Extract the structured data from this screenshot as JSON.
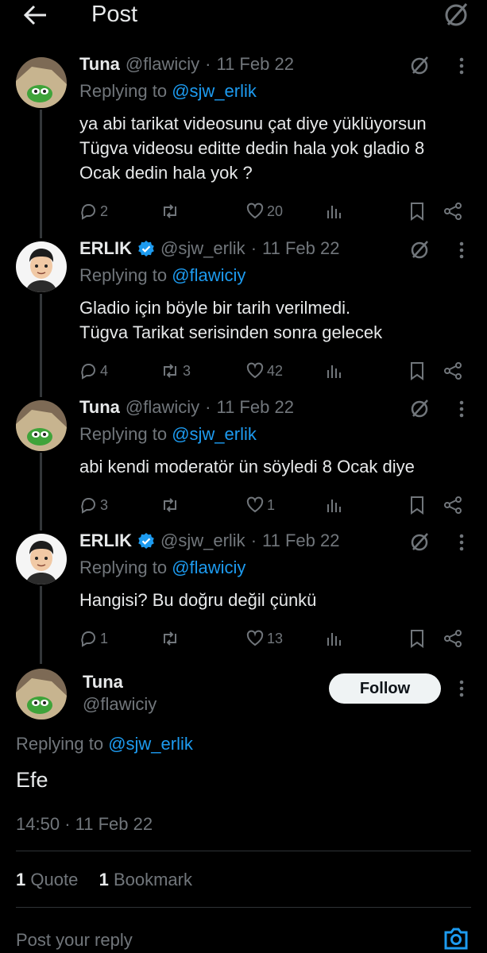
{
  "header": {
    "title": "Post",
    "back_icon": "arrow-left-icon",
    "grok_icon": "slash-circle-icon"
  },
  "replies": [
    {
      "name": "Tuna",
      "handle": "@flawiciy",
      "sep": "·",
      "date": "11 Feb 22",
      "replying_prefix": "Replying to",
      "replying_to": "@sjw_erlik",
      "text": [
        "ya abi tarikat videosunu çat diye yüklüyorsun",
        "Tügva videosu editte dedin hala yok gladio 8",
        "Ocak dedin hala yok ?"
      ],
      "replies": "2",
      "reposts": "",
      "likes": "20"
    },
    {
      "name": "ERLIK",
      "verified": true,
      "handle": "@sjw_erlik",
      "sep": "·",
      "date": "11 Feb 22",
      "replying_prefix": "Replying to",
      "replying_to": "@flawiciy",
      "text": [
        "Gladio için böyle bir tarih verilmedi.",
        "Tügva Tarikat serisinden sonra gelecek"
      ],
      "replies": "4",
      "reposts": "3",
      "likes": "42"
    },
    {
      "name": "Tuna",
      "handle": "@flawiciy",
      "sep": "·",
      "date": "11 Feb 22",
      "replying_prefix": "Replying to",
      "replying_to": "@sjw_erlik",
      "text": [
        "abi kendi moderatör ün söyledi 8 Ocak diye"
      ],
      "replies": "3",
      "reposts": "",
      "likes": "1"
    },
    {
      "name": "ERLIK",
      "verified": true,
      "handle": "@sjw_erlik",
      "sep": "·",
      "date": "11 Feb 22",
      "replying_prefix": "Replying to",
      "replying_to": "@flawiciy",
      "text": [
        "Hangisi? Bu doğru değil çünkü"
      ],
      "replies": "1",
      "reposts": "",
      "likes": "13"
    }
  ],
  "main_post": {
    "name": "Tuna",
    "handle": "@flawiciy",
    "follow_label": "Follow",
    "replying_prefix": "Replying to",
    "replying_to": "@sjw_erlik",
    "text": "Efe",
    "time": "14:50",
    "sep": "·",
    "date": "11 Feb 22",
    "stats": {
      "quote_count": "1",
      "quote_label": "Quote",
      "bookmark_count": "1",
      "bookmark_label": "Bookmark"
    }
  },
  "composer": {
    "placeholder": "Post your reply",
    "icon": "camera-icon"
  },
  "colors": {
    "background": "#000000",
    "text": "#e7e9ea",
    "muted": "#71767b",
    "link": "#1d9bf0",
    "verified": "#1d9bf0"
  }
}
